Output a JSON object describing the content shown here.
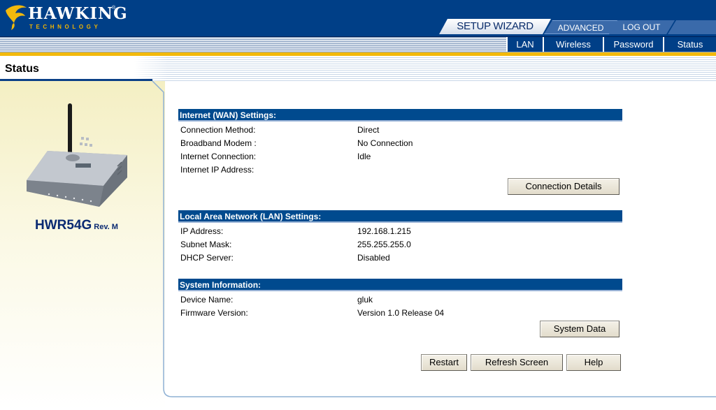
{
  "brand": {
    "name": "HAWKING",
    "registered": "®",
    "subtitle": "TECHNOLOGY"
  },
  "top_tabs": {
    "setup_wizard": "SETUP WIZARD",
    "advanced": "ADVANCED",
    "logout": "LOG OUT"
  },
  "sub_nav": [
    {
      "label": "LAN"
    },
    {
      "label": "Wireless"
    },
    {
      "label": "Password"
    },
    {
      "label": "Status"
    }
  ],
  "page_title": "Status",
  "product": {
    "model": "HWR54G",
    "revision": "Rev. M"
  },
  "wan": {
    "heading": "Internet (WAN)  Settings:",
    "rows": [
      {
        "label": "Connection Method:",
        "value": "Direct"
      },
      {
        "label": "Broadband Modem :",
        "value": "No Connection"
      },
      {
        "label": "Internet Connection:",
        "value": "Idle"
      },
      {
        "label": "Internet IP Address:",
        "value": ""
      }
    ],
    "button": "Connection Details"
  },
  "lan": {
    "heading": "Local Area Network (LAN) Settings:",
    "rows": [
      {
        "label": "IP Address:",
        "value": "192.168.1.215"
      },
      {
        "label": "Subnet Mask:",
        "value": "255.255.255.0"
      },
      {
        "label": "DHCP Server:",
        "value": "Disabled"
      }
    ]
  },
  "system": {
    "heading": "System Information:",
    "rows": [
      {
        "label": "Device Name:",
        "value": "gluk"
      },
      {
        "label": "Firmware Version:",
        "value": "Version 1.0 Release 04"
      }
    ],
    "button": "System Data"
  },
  "actions": {
    "restart": "Restart",
    "refresh": "Refresh Screen",
    "help": "Help"
  },
  "colors": {
    "header": "#003f87",
    "accent": "#f2b90c",
    "section": "#004a8e",
    "model_text": "#0a2a72"
  }
}
